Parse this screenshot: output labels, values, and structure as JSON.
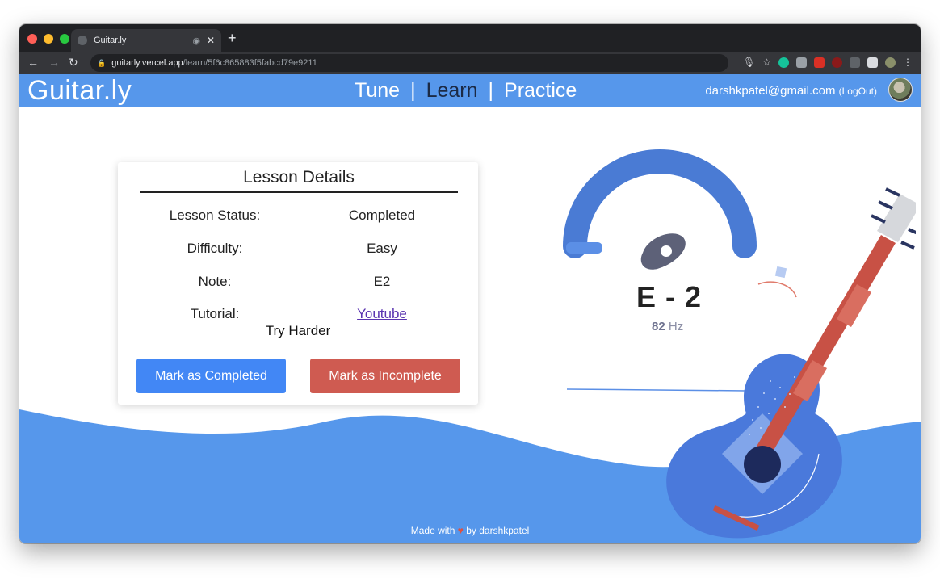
{
  "browser": {
    "tab_title": "Guitar.ly",
    "url_host": "guitarly.vercel.app",
    "url_path": "/learn/5f6c865883f5fabcd79e9211",
    "traffic_lights": [
      "#ff5f57",
      "#febc2e",
      "#28c840"
    ]
  },
  "app": {
    "brand": "Guitar.ly",
    "nav": [
      {
        "label": "Tune"
      },
      {
        "label": "Learn",
        "active": true
      },
      {
        "label": "Practice"
      }
    ],
    "user_email": "darshkpatel@gmail.com",
    "logout_label": "(LogOut)",
    "accent": "#5697eb"
  },
  "lesson": {
    "title": "Lesson Details",
    "rows": [
      {
        "key": "Lesson Status:",
        "value": "Completed"
      },
      {
        "key": "Difficulty:",
        "value": "Easy"
      },
      {
        "key": "Note:",
        "value": "E2"
      },
      {
        "key": "Tutorial:",
        "value": "Youtube"
      }
    ],
    "verdict": "Try Harder",
    "complete_button": "Mark as Completed",
    "incomplete_button": "Mark as Incomplete"
  },
  "tuner": {
    "note": "E - 2",
    "frequency": "82",
    "unit": "Hz"
  },
  "footer": {
    "prefix": "Made with",
    "heart": "♥",
    "suffix": "by darshkpatel"
  }
}
